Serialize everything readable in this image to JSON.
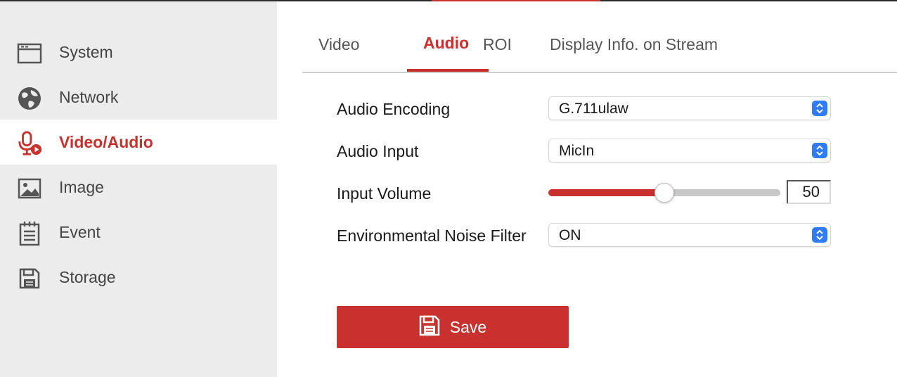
{
  "sidebar": {
    "items": [
      {
        "label": "System",
        "icon": "window-icon"
      },
      {
        "label": "Network",
        "icon": "globe-icon"
      },
      {
        "label": "Video/Audio",
        "icon": "microphone-play-icon",
        "active": true
      },
      {
        "label": "Image",
        "icon": "image-icon"
      },
      {
        "label": "Event",
        "icon": "calendar-list-icon"
      },
      {
        "label": "Storage",
        "icon": "floppy-disk-icon"
      }
    ]
  },
  "tabs": [
    {
      "label": "Video"
    },
    {
      "label": "Audio",
      "active": true
    },
    {
      "label": "ROI"
    },
    {
      "label": "Display Info. on Stream"
    }
  ],
  "form": {
    "audio_encoding": {
      "label": "Audio Encoding",
      "value": "G.711ulaw"
    },
    "audio_input": {
      "label": "Audio Input",
      "value": "MicIn"
    },
    "input_volume": {
      "label": "Input Volume",
      "value": "50",
      "fraction": 0.5
    },
    "noise_filter": {
      "label": "Environmental Noise Filter",
      "value": "ON"
    }
  },
  "save": {
    "label": "Save",
    "icon": "floppy-disk-icon"
  },
  "colors": {
    "accent": "#c8312e",
    "select_arrow": "#2f7cf6"
  }
}
